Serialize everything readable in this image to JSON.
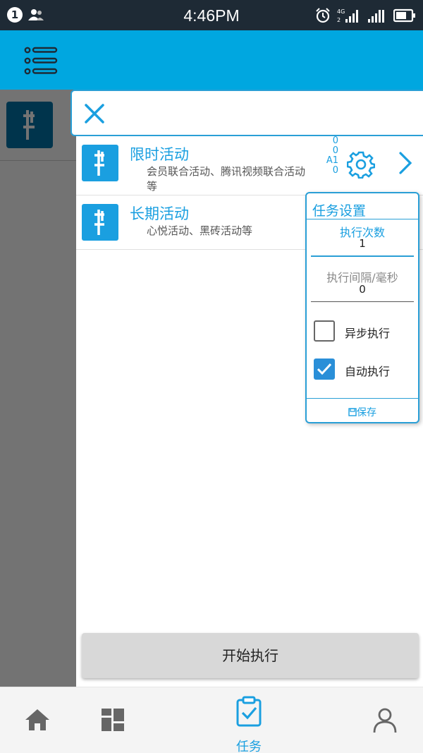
{
  "status_bar": {
    "notification_count": "1",
    "time": "4:46PM",
    "network_label_1": "4G",
    "network_label_2": "2"
  },
  "app_bar": {
    "menu_icon": "menu-list-icon"
  },
  "activities": [
    {
      "title": "限时活动",
      "description": "会员联合活动、腾讯视频联合活动等",
      "counters": [
        "0",
        "0",
        "A1",
        "0"
      ]
    },
    {
      "title": "长期活动",
      "description": "心悦活动、黑砖活动等"
    }
  ],
  "task_settings": {
    "title": "任务设置",
    "exec_count_label": "执行次数",
    "exec_count_value": "1",
    "interval_label": "执行间隔/毫秒",
    "interval_value": "0",
    "async_label": "异步执行",
    "async_checked": false,
    "auto_label": "自动执行",
    "auto_checked": true,
    "save_label": "保存"
  },
  "start_button": {
    "label": "开始执行"
  },
  "bottom_nav": {
    "task_label": "任务"
  },
  "colors": {
    "accent": "#1a9fe0",
    "app_bar": "#00a7e0",
    "status_bar": "#1e2a35"
  }
}
